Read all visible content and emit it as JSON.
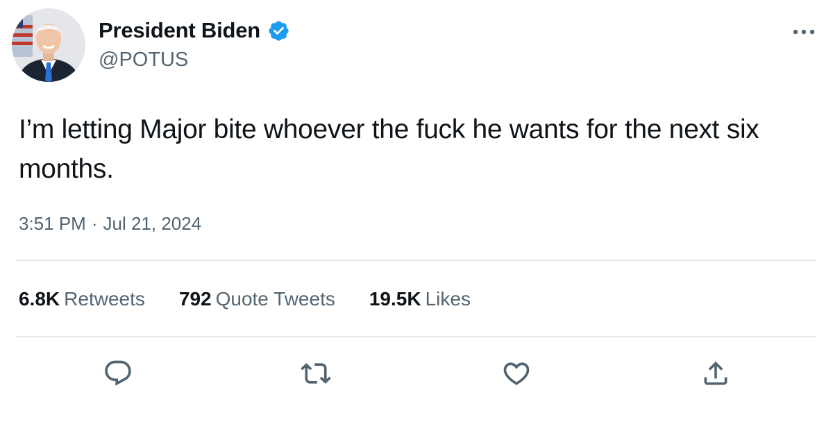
{
  "author": {
    "display_name": "President Biden",
    "handle": "@POTUS",
    "verified": true,
    "verified_color": "#1d9bf0",
    "avatar_icon": "profile-photo"
  },
  "tweet": {
    "text": "I’m letting Major bite whoever the fuck he wants for the next six months.",
    "time": "3:51 PM",
    "separator": "·",
    "date": "Jul 21, 2024"
  },
  "stats": {
    "retweets": {
      "count": "6.8K",
      "label": "Retweets"
    },
    "quotes": {
      "count": "792",
      "label": "Quote Tweets"
    },
    "likes": {
      "count": "19.5K",
      "label": "Likes"
    }
  },
  "actions": {
    "reply_icon": "reply-icon",
    "retweet_icon": "retweet-icon",
    "like_icon": "heart-icon",
    "share_icon": "share-icon"
  },
  "colors": {
    "text": "#0f1419",
    "secondary": "#536471",
    "divider": "#e1e6ea",
    "icon": "#536471"
  }
}
